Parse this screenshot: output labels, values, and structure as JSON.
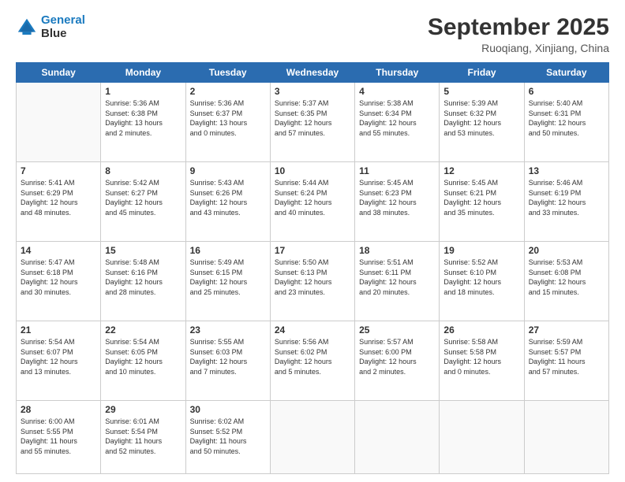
{
  "header": {
    "logo_line1": "General",
    "logo_line2": "Blue",
    "month_year": "September 2025",
    "location": "Ruoqiang, Xinjiang, China"
  },
  "days_of_week": [
    "Sunday",
    "Monday",
    "Tuesday",
    "Wednesday",
    "Thursday",
    "Friday",
    "Saturday"
  ],
  "weeks": [
    [
      {
        "day": "",
        "info": ""
      },
      {
        "day": "1",
        "info": "Sunrise: 5:36 AM\nSunset: 6:38 PM\nDaylight: 13 hours\nand 2 minutes."
      },
      {
        "day": "2",
        "info": "Sunrise: 5:36 AM\nSunset: 6:37 PM\nDaylight: 13 hours\nand 0 minutes."
      },
      {
        "day": "3",
        "info": "Sunrise: 5:37 AM\nSunset: 6:35 PM\nDaylight: 12 hours\nand 57 minutes."
      },
      {
        "day": "4",
        "info": "Sunrise: 5:38 AM\nSunset: 6:34 PM\nDaylight: 12 hours\nand 55 minutes."
      },
      {
        "day": "5",
        "info": "Sunrise: 5:39 AM\nSunset: 6:32 PM\nDaylight: 12 hours\nand 53 minutes."
      },
      {
        "day": "6",
        "info": "Sunrise: 5:40 AM\nSunset: 6:31 PM\nDaylight: 12 hours\nand 50 minutes."
      }
    ],
    [
      {
        "day": "7",
        "info": "Sunrise: 5:41 AM\nSunset: 6:29 PM\nDaylight: 12 hours\nand 48 minutes."
      },
      {
        "day": "8",
        "info": "Sunrise: 5:42 AM\nSunset: 6:27 PM\nDaylight: 12 hours\nand 45 minutes."
      },
      {
        "day": "9",
        "info": "Sunrise: 5:43 AM\nSunset: 6:26 PM\nDaylight: 12 hours\nand 43 minutes."
      },
      {
        "day": "10",
        "info": "Sunrise: 5:44 AM\nSunset: 6:24 PM\nDaylight: 12 hours\nand 40 minutes."
      },
      {
        "day": "11",
        "info": "Sunrise: 5:45 AM\nSunset: 6:23 PM\nDaylight: 12 hours\nand 38 minutes."
      },
      {
        "day": "12",
        "info": "Sunrise: 5:45 AM\nSunset: 6:21 PM\nDaylight: 12 hours\nand 35 minutes."
      },
      {
        "day": "13",
        "info": "Sunrise: 5:46 AM\nSunset: 6:19 PM\nDaylight: 12 hours\nand 33 minutes."
      }
    ],
    [
      {
        "day": "14",
        "info": "Sunrise: 5:47 AM\nSunset: 6:18 PM\nDaylight: 12 hours\nand 30 minutes."
      },
      {
        "day": "15",
        "info": "Sunrise: 5:48 AM\nSunset: 6:16 PM\nDaylight: 12 hours\nand 28 minutes."
      },
      {
        "day": "16",
        "info": "Sunrise: 5:49 AM\nSunset: 6:15 PM\nDaylight: 12 hours\nand 25 minutes."
      },
      {
        "day": "17",
        "info": "Sunrise: 5:50 AM\nSunset: 6:13 PM\nDaylight: 12 hours\nand 23 minutes."
      },
      {
        "day": "18",
        "info": "Sunrise: 5:51 AM\nSunset: 6:11 PM\nDaylight: 12 hours\nand 20 minutes."
      },
      {
        "day": "19",
        "info": "Sunrise: 5:52 AM\nSunset: 6:10 PM\nDaylight: 12 hours\nand 18 minutes."
      },
      {
        "day": "20",
        "info": "Sunrise: 5:53 AM\nSunset: 6:08 PM\nDaylight: 12 hours\nand 15 minutes."
      }
    ],
    [
      {
        "day": "21",
        "info": "Sunrise: 5:54 AM\nSunset: 6:07 PM\nDaylight: 12 hours\nand 13 minutes."
      },
      {
        "day": "22",
        "info": "Sunrise: 5:54 AM\nSunset: 6:05 PM\nDaylight: 12 hours\nand 10 minutes."
      },
      {
        "day": "23",
        "info": "Sunrise: 5:55 AM\nSunset: 6:03 PM\nDaylight: 12 hours\nand 7 minutes."
      },
      {
        "day": "24",
        "info": "Sunrise: 5:56 AM\nSunset: 6:02 PM\nDaylight: 12 hours\nand 5 minutes."
      },
      {
        "day": "25",
        "info": "Sunrise: 5:57 AM\nSunset: 6:00 PM\nDaylight: 12 hours\nand 2 minutes."
      },
      {
        "day": "26",
        "info": "Sunrise: 5:58 AM\nSunset: 5:58 PM\nDaylight: 12 hours\nand 0 minutes."
      },
      {
        "day": "27",
        "info": "Sunrise: 5:59 AM\nSunset: 5:57 PM\nDaylight: 11 hours\nand 57 minutes."
      }
    ],
    [
      {
        "day": "28",
        "info": "Sunrise: 6:00 AM\nSunset: 5:55 PM\nDaylight: 11 hours\nand 55 minutes."
      },
      {
        "day": "29",
        "info": "Sunrise: 6:01 AM\nSunset: 5:54 PM\nDaylight: 11 hours\nand 52 minutes."
      },
      {
        "day": "30",
        "info": "Sunrise: 6:02 AM\nSunset: 5:52 PM\nDaylight: 11 hours\nand 50 minutes."
      },
      {
        "day": "",
        "info": ""
      },
      {
        "day": "",
        "info": ""
      },
      {
        "day": "",
        "info": ""
      },
      {
        "day": "",
        "info": ""
      }
    ]
  ]
}
